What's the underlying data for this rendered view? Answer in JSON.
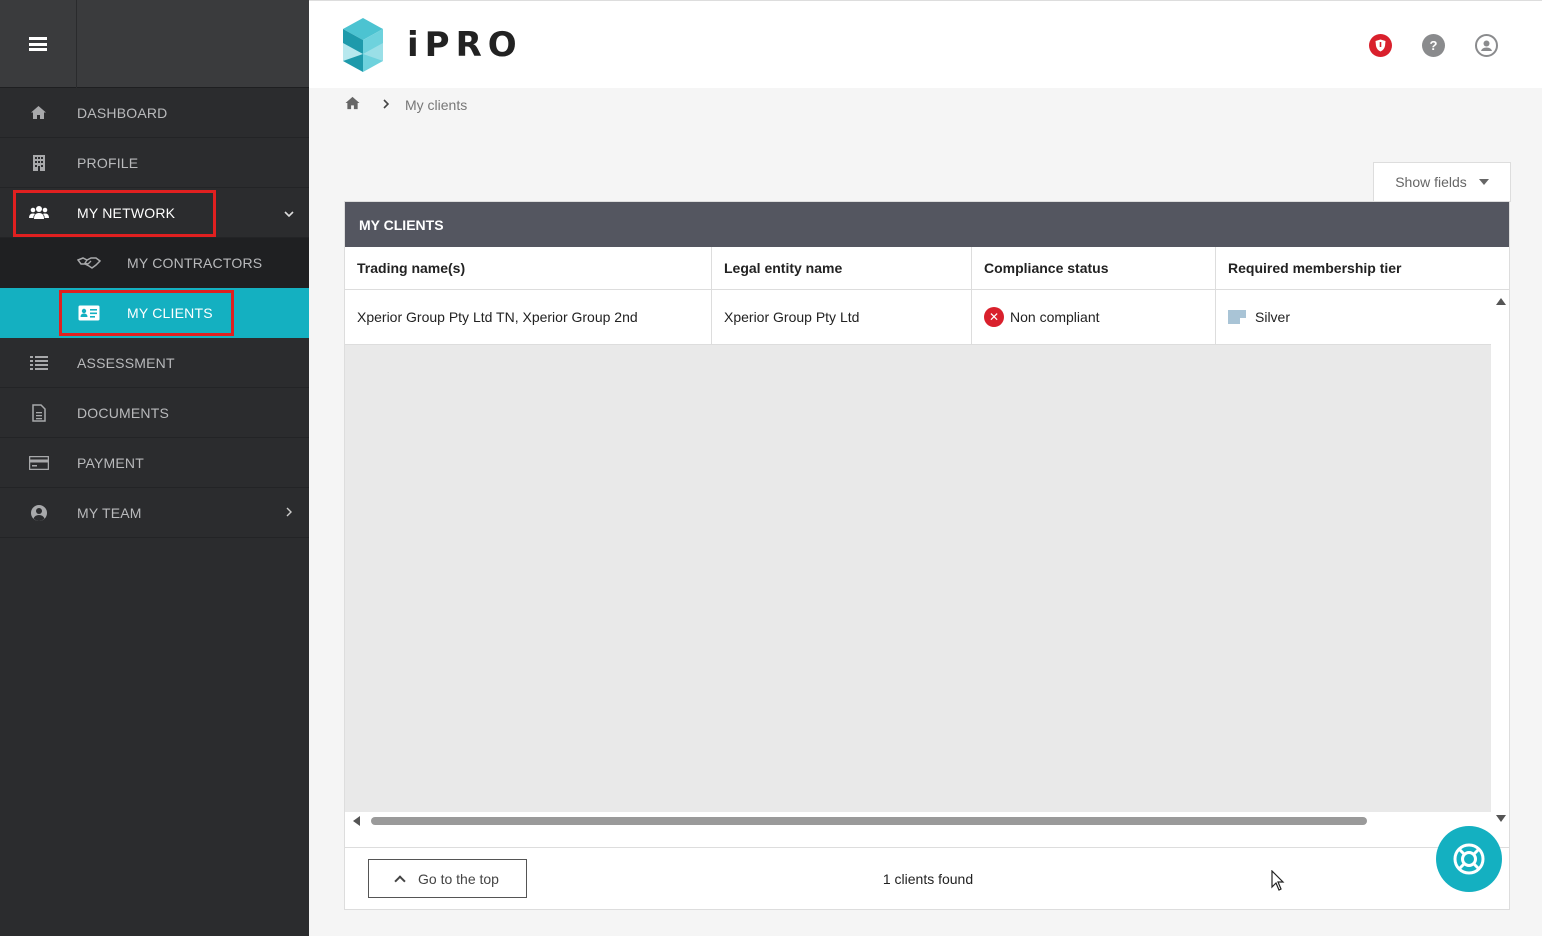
{
  "app": {
    "name": "iPRO"
  },
  "sidebar": {
    "items": [
      {
        "label": "DASHBOARD",
        "icon": "home-icon"
      },
      {
        "label": "PROFILE",
        "icon": "building-icon"
      },
      {
        "label": "MY NETWORK",
        "icon": "users-icon",
        "expanded": true
      },
      {
        "label": "MY CONTRACTORS",
        "icon": "handshake-icon"
      },
      {
        "label": "MY CLIENTS",
        "icon": "id-card-icon",
        "selected": true
      },
      {
        "label": "ASSESSMENT",
        "icon": "list-icon"
      },
      {
        "label": "DOCUMENTS",
        "icon": "document-icon"
      },
      {
        "label": "PAYMENT",
        "icon": "credit-card-icon"
      },
      {
        "label": "MY TEAM",
        "icon": "user-circle-icon"
      }
    ]
  },
  "breadcrumb": {
    "current": "My clients"
  },
  "toolbar": {
    "show_fields": "Show fields"
  },
  "panel": {
    "title": "MY CLIENTS",
    "columns": [
      "Trading name(s)",
      "Legal entity name",
      "Compliance status",
      "Required membership tier"
    ],
    "rows": [
      {
        "trading_name": "Xperior Group Pty Ltd TN, Xperior Group 2nd",
        "legal_entity": "Xperior Group Pty Ltd",
        "compliance": "Non compliant",
        "tier": "Silver"
      }
    ],
    "footer": {
      "go_top": "Go to the top",
      "count": "1 clients found"
    }
  },
  "colors": {
    "accent": "#14b0c1",
    "sidebar": "#2b2c2e",
    "panel_header": "#545660",
    "error": "#d9202c",
    "highlight": "#e02020"
  }
}
